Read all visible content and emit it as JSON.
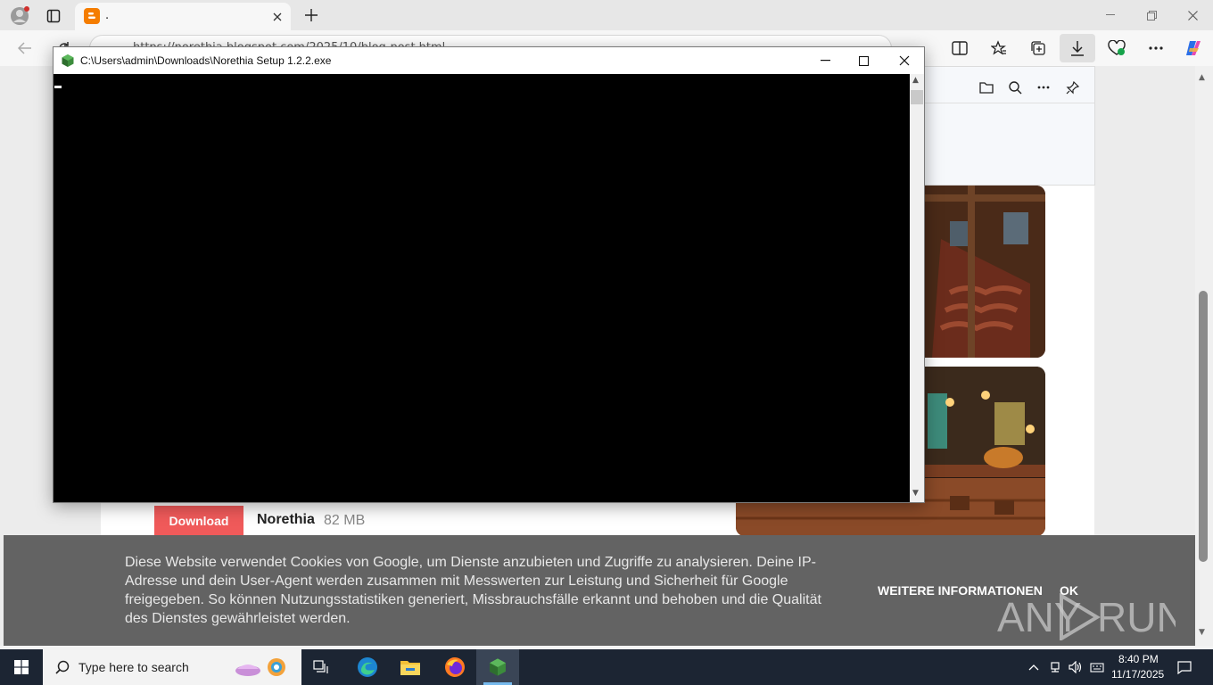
{
  "browser": {
    "tab_title": ".",
    "address_text": "https://norethia.blogspot.com/2025/10/blog-post.html",
    "accent_color": "#f57d00"
  },
  "page": {
    "download_button_label": "Download",
    "file_name": "Norethia",
    "file_size": "82 MB",
    "download_button_color": "#f05a5a"
  },
  "console": {
    "title": "C:\\Users\\admin\\Downloads\\Norethia Setup 1.2.2.exe"
  },
  "cookie_banner": {
    "text": "Diese Website verwendet Cookies von Google, um Dienste anzubieten und Zugriffe zu analysieren. Deine IP-Adresse und dein User-Agent werden zusammen mit Messwerten zur Leistung und Sicherheit für Google freigegeben. So können Nutzungsstatistiken generiert, Missbrauchsfälle erkannt und behoben und die Qualität des Dienstes gewährleistet werden.",
    "more_info_label": "WEITERE INFORMATIONEN",
    "ok_label": "OK"
  },
  "watermark": "ANY RUN",
  "taskbar": {
    "search_placeholder": "Type here to search",
    "time": "8:40 PM",
    "date": "11/17/2025"
  }
}
